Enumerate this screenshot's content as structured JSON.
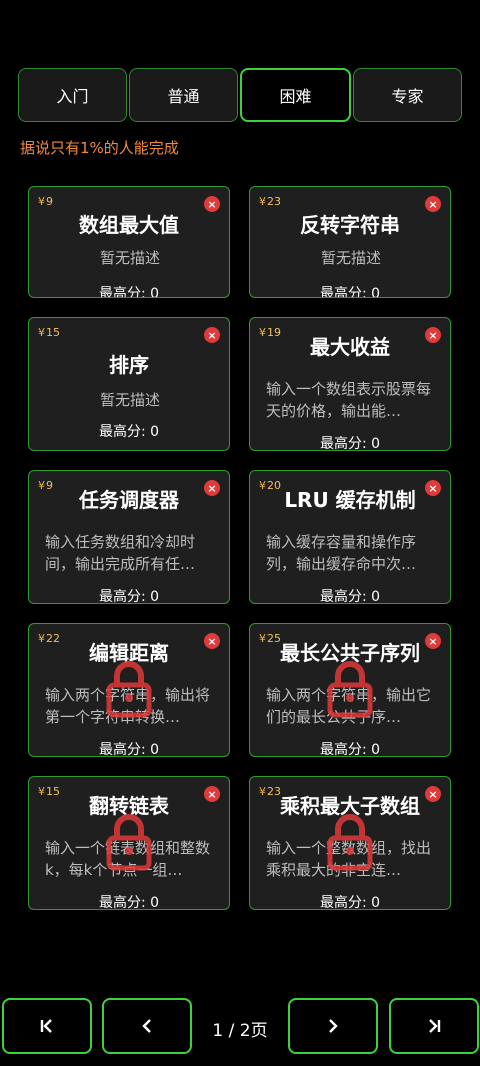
{
  "tabs": [
    {
      "label": "入门",
      "active": false
    },
    {
      "label": "普通",
      "active": false
    },
    {
      "label": "困难",
      "active": true
    },
    {
      "label": "专家",
      "active": false
    }
  ],
  "hint": "据说只有1%的人能完成",
  "currency_symbol": "¥",
  "score_prefix": "最高分: ",
  "cards": [
    {
      "price": "9",
      "title": "数组最大值",
      "desc": "暂无描述",
      "score": "0",
      "locked": false
    },
    {
      "price": "23",
      "title": "反转字符串",
      "desc": "暂无描述",
      "score": "0",
      "locked": false
    },
    {
      "price": "15",
      "title": "排序",
      "desc": "暂无描述",
      "score": "0",
      "locked": false
    },
    {
      "price": "19",
      "title": "最大收益",
      "desc": "输入一个数组表示股票每天的价格，输出能…",
      "score": "0",
      "locked": false
    },
    {
      "price": "9",
      "title": "任务调度器",
      "desc": "输入任务数组和冷却时间，输出完成所有任…",
      "score": "0",
      "locked": false
    },
    {
      "price": "20",
      "title": "LRU 缓存机制",
      "desc": "输入缓存容量和操作序列，输出缓存命中次…",
      "score": "0",
      "locked": false
    },
    {
      "price": "22",
      "title": "编辑距离",
      "desc": "输入两个字符串，输出将第一个字符串转换…",
      "score": "0",
      "locked": true
    },
    {
      "price": "25",
      "title": "最长公共子序列",
      "desc": "输入两个字符串，输出它们的最长公共子序…",
      "score": "0",
      "locked": true
    },
    {
      "price": "15",
      "title": "翻转链表",
      "desc": "输入一个链表数组和整数k，每k个节点一组…",
      "score": "0",
      "locked": true
    },
    {
      "price": "23",
      "title": "乘积最大子数组",
      "desc": "输入一个整数数组，找出乘积最大的非空连…",
      "score": "0",
      "locked": true
    }
  ],
  "pagination": {
    "current": "1",
    "total": "2",
    "text": "1 / 2页",
    "first_icon": "first-page-icon",
    "prev_icon": "prev-page-icon",
    "next_icon": "next-page-icon",
    "last_icon": "last-page-icon"
  },
  "colors": {
    "accent_green": "#3cd23c",
    "hint_orange": "#f08a3c",
    "close_red": "#e03a3a",
    "lock_red": "#e03a3a",
    "price_gold": "#f0c060"
  },
  "icons": {
    "close": "close-icon",
    "lock": "lock-icon"
  }
}
